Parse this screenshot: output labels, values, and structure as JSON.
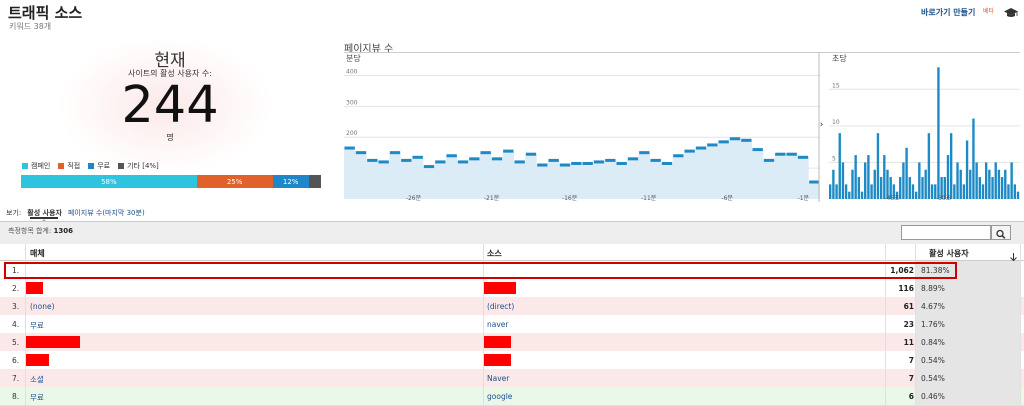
{
  "header": {
    "title": "트래픽 소스",
    "subtitle": "키워드 38개",
    "shortcut": "바로가기 만들기",
    "beta": "베타",
    "cap_icon": "graduation-cap-icon"
  },
  "overview": {
    "now": "현재",
    "active_users_label": "사이트의 활성 사용자 수:",
    "active_count": "244",
    "unit": "명",
    "legend": [
      {
        "label": "캠페인",
        "color": "#2ec4dd"
      },
      {
        "label": "직접",
        "color": "#e0612a"
      },
      {
        "label": "무료",
        "color": "#1f86c9"
      },
      {
        "label": "기타 [4%]",
        "color": "#555555"
      }
    ],
    "bar": [
      {
        "label": "58%",
        "value": 58,
        "color": "#2ec4dd"
      },
      {
        "label": "25%",
        "value": 25,
        "color": "#e0612a"
      },
      {
        "label": "12%",
        "value": 12,
        "color": "#1f86c9"
      },
      {
        "label": "",
        "value": 4,
        "color": "#555555"
      }
    ]
  },
  "pageviews": {
    "title": "페이지뷰 수",
    "toggle_icon": "chevron-right-icon",
    "per_minute": {
      "label": "분당",
      "yticks": [
        "400",
        "300",
        "200",
        "100"
      ],
      "xticks": [
        "-26분",
        "-21분",
        "-16분",
        "-11분",
        "-6분",
        "-1분"
      ],
      "values": [
        165,
        150,
        125,
        120,
        150,
        125,
        135,
        105,
        120,
        140,
        120,
        130,
        150,
        130,
        155,
        120,
        145,
        110,
        125,
        110,
        115,
        115,
        120,
        125,
        115,
        130,
        150,
        125,
        115,
        140,
        155,
        165,
        175,
        185,
        195,
        190,
        160,
        125,
        145,
        145,
        135,
        55
      ],
      "ymax": 450,
      "fill": "#dcecf7",
      "color": "#1d8ac5"
    },
    "per_second": {
      "label": "초당",
      "yticks": [
        "15",
        "10",
        "5"
      ],
      "xticks": [
        "-45초",
        "-30초"
      ],
      "values": [
        2,
        4,
        2,
        9,
        5,
        2,
        1,
        4,
        6,
        3,
        1,
        5,
        6,
        2,
        4,
        9,
        3,
        6,
        4,
        3,
        2,
        1,
        3,
        5,
        7,
        3,
        2,
        1,
        5,
        3,
        4,
        9,
        2,
        2,
        18,
        3,
        3,
        6,
        9,
        2,
        5,
        4,
        2,
        8,
        4,
        11,
        5,
        3,
        2,
        5,
        4,
        3,
        5,
        4,
        3,
        4,
        2,
        5,
        2,
        1
      ],
      "ymax": 19,
      "color": "#1d8ac5"
    }
  },
  "view": {
    "label": "보기:",
    "tab_active": "활성 사용자",
    "tab_other": "페이지뷰 수(마지막 30분)"
  },
  "table": {
    "total_label": "측정항목 합계:",
    "total_value": "1306",
    "search_icon": "magnifier-icon",
    "headers": {
      "medium": "매체",
      "source": "소스",
      "active": "활성 사용자",
      "sort_icon": "down-arrow-icon"
    },
    "rows": [
      {
        "num": "1.",
        "medium": "",
        "source": "",
        "count": "1,062",
        "pct": "81.38%",
        "bg": "#ffffff",
        "red_med": 0,
        "red_src": 0
      },
      {
        "num": "2.",
        "medium": "",
        "source": "",
        "count": "116",
        "pct": "8.89%",
        "bg": "#ffffff",
        "red_med": 17,
        "red_src": 32
      },
      {
        "num": "3.",
        "medium": "(none)",
        "source": "(direct)",
        "count": "61",
        "pct": "4.67%",
        "bg": "#fbe9e9",
        "red_med": 0,
        "red_src": 0
      },
      {
        "num": "4.",
        "medium": "무료",
        "source": "naver",
        "count": "23",
        "pct": "1.76%",
        "bg": "#ffffff",
        "red_med": 0,
        "red_src": 0
      },
      {
        "num": "5.",
        "medium": "",
        "source": "",
        "count": "11",
        "pct": "0.84%",
        "bg": "#fbe9e9",
        "red_med": 54,
        "red_src": 27
      },
      {
        "num": "6.",
        "medium": "",
        "source": "",
        "count": "7",
        "pct": "0.54%",
        "bg": "#ffffff",
        "red_med": 23,
        "red_src": 27
      },
      {
        "num": "7.",
        "medium": "소셜",
        "source": "Naver",
        "count": "7",
        "pct": "0.54%",
        "bg": "#fbe9e9",
        "red_med": 0,
        "red_src": 0
      },
      {
        "num": "8.",
        "medium": "무료",
        "source": "google",
        "count": "6",
        "pct": "0.46%",
        "bg": "#eaf8ea",
        "red_med": 0,
        "red_src": 0
      }
    ]
  }
}
